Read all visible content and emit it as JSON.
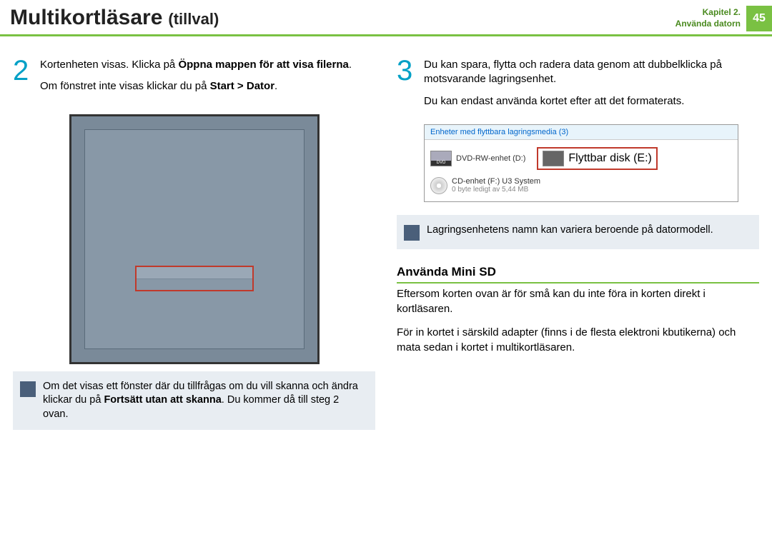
{
  "header": {
    "title_main": "Multikortläsare",
    "title_sub": "(tillval)",
    "chapter_line1": "Kapitel 2.",
    "chapter_line2": "Använda datorn",
    "page_num": "45"
  },
  "left": {
    "step_num": "2",
    "p1_pre": "Kortenheten visas. Klicka på ",
    "p1_bold": "Öppna mappen för att visa filerna",
    "p1_post": ".",
    "p2_pre": "Om fönstret inte visas klickar du på ",
    "p2_bold": "Start > Dator",
    "p2_post": ".",
    "note_pre": "Om det visas ett fönster där du tillfrågas om du vill skanna och ändra klickar du på ",
    "note_bold": "Fortsätt utan att skanna",
    "note_mid": ". Du kommer då till steg 2 ovan."
  },
  "right": {
    "step_num": "3",
    "p1": "Du kan spara, flytta och radera data genom att dubbelklicka på motsvarande lagringsenhet.",
    "p2": "Du kan endast använda kortet efter att det formaterats.",
    "devices_header": "Enheter med flyttbara lagringsmedia (3)",
    "device1": "DVD-RW-enhet (D:)",
    "device2": "Flyttbar disk (E:)",
    "device3_line1": "CD-enhet (F:) U3 System",
    "device3_line2": "0 byte ledigt av 5,44 MB",
    "note": "Lagringsenhetens namn kan variera beroende på datormodell.",
    "section_title": "Använda Mini SD",
    "para1": "Eftersom korten ovan är för små kan du inte föra in korten direkt i kortläsaren.",
    "para2": "För in kortet i särskild adapter (finns i de flesta elektroni kbutikerna) och mata sedan i kortet i multikortläsaren."
  }
}
